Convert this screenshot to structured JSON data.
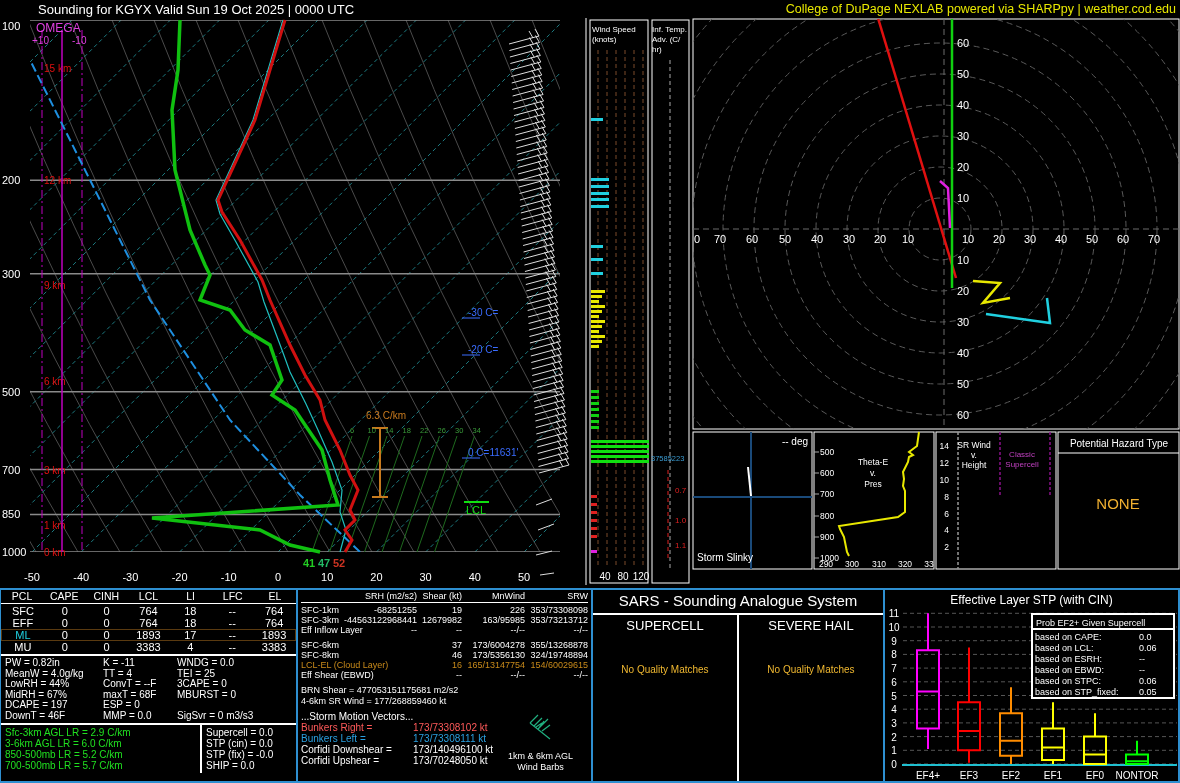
{
  "header": {
    "title": "Sounding for KGYX Valid  Sun 19 Oct 2025 | 0000 UTC",
    "credit": "College of DuPage NEXLAB powered via SHARPpy | weather.cod.edu"
  },
  "skew_t": {
    "pressure_labels": [
      "100",
      "200",
      "300",
      "500",
      "700",
      "850",
      "1000"
    ],
    "temperature_labels": [
      "-50",
      "-40",
      "-30",
      "-20",
      "-10",
      "0",
      "10",
      "20",
      "30",
      "40",
      "50"
    ],
    "height_labels": [
      "15 km",
      "12 km",
      "9 km",
      "6 km",
      "3 km",
      "1 km",
      "0 km"
    ],
    "omega": {
      "title": "OMEGA",
      "ticks": [
        "+10",
        "-10"
      ]
    },
    "lapse_rate": "6.3 C/km",
    "mixing_ratio_labels": [
      "6",
      "10",
      "14",
      "18",
      "22",
      "26",
      "30",
      "34"
    ],
    "level_labels": [
      "-30 C=",
      "-20 C=",
      "0 C=11631'"
    ],
    "lcl_label": "LCL",
    "surface_values": [
      {
        "text": "41",
        "color": "#22cc22"
      },
      {
        "text": "47",
        "color": "#22bb66"
      },
      {
        "text": "52",
        "color": "#cc3322"
      }
    ]
  },
  "wind_speed": {
    "title_lines": [
      "Wind Speed",
      "(knots)"
    ],
    "axis_labels": [
      "40",
      "80",
      "120"
    ]
  },
  "temp_advection": {
    "title_lines": [
      "Inf. Temp.",
      "Adv. (C/",
      "hr)"
    ],
    "values": [
      "0.7",
      "1.0",
      "1.1"
    ],
    "side_value": "37585223"
  },
  "hodograph": {
    "up_labels": [
      "60",
      "50",
      "40",
      "30",
      "20",
      "10"
    ],
    "down_labels": [
      "10",
      "20",
      "30",
      "40",
      "50",
      "60"
    ],
    "left_labels": [
      "0",
      "70",
      "60",
      "50",
      "40",
      "30",
      "20",
      "10"
    ],
    "right_labels": [
      "10",
      "20",
      "30",
      "40",
      "50",
      "60",
      "70"
    ]
  },
  "storm_slinky": {
    "direction": "-- deg",
    "title": "Storm Slinky"
  },
  "theta_e": {
    "title_lines": [
      "Theta-E",
      "v.",
      "Pres"
    ],
    "pressure_labels": [
      "500",
      "600",
      "700",
      "800",
      "900",
      "1000"
    ],
    "theta_labels": [
      "290",
      "300",
      "310",
      "320",
      "33"
    ]
  },
  "sr_wind": {
    "title_lines": [
      "SR Wind",
      "v.",
      "Height"
    ],
    "height_labels": [
      "14",
      "12",
      "10",
      "8",
      "6",
      "4",
      "2"
    ],
    "classic_lines": [
      "Classic",
      "Supercell"
    ]
  },
  "hazard": {
    "title": "Potential Hazard Type",
    "value": "NONE"
  },
  "thermo": {
    "columns": [
      "PCL",
      "CAPE",
      "CINH",
      "LCL",
      "LI",
      "LFC",
      "EL"
    ],
    "parcels": [
      {
        "cells": [
          "SFC",
          "0",
          "0",
          "764",
          "18",
          "--",
          "764"
        ],
        "selected": false
      },
      {
        "cells": [
          "EFF",
          "0",
          "0",
          "764",
          "18",
          "--",
          "764"
        ],
        "selected": false
      },
      {
        "cells": [
          "ML",
          "0",
          "0",
          "1893",
          "17",
          "--",
          "1893"
        ],
        "selected": true
      },
      {
        "cells": [
          "MU",
          "0",
          "0",
          "3383",
          "4",
          "--",
          "3383"
        ],
        "selected": false
      }
    ],
    "indices": [
      [
        "PW = 0.82in",
        "K = -11",
        "WNDG = 0.0"
      ],
      [
        "MeanW = 4.0g/kg",
        "TT = 4",
        "TEI = 25"
      ],
      [
        "LowRH = 44%",
        "ConvT = --F",
        "3CAPE = 0"
      ],
      [
        "MidRH = 67%",
        "maxT = 68F",
        "MBURST = 0"
      ],
      [
        "DCAPE = 197",
        "ESP = 0"
      ],
      [
        "DownT = 46F",
        "MMP = 0.0",
        "SigSvr = 0 m3/s3"
      ]
    ],
    "lapse_rates": [
      "Sfc-3km AGL LR = 2.9 C/km",
      "3-6km AGL LR = 6.0 C/km",
      "850-500mb LR = 5.2 C/km",
      "700-500mb LR = 5.7 C/km"
    ],
    "composites": [
      "Supercell = 0.0",
      "STP (cin) = 0.0",
      "STP (fix) = -0.0",
      "SHIP = 0.0"
    ]
  },
  "kinematics": {
    "columns": [
      "SRH (m2/s2)",
      "Shear (kt)",
      "MnWind",
      "SRW"
    ],
    "groups": [
      [
        {
          "label": "SFC-1km",
          "srh": "-68251255",
          "shear": "19",
          "mnwind": "226",
          "srw": "353/73308098",
          "kind": "normal"
        },
        {
          "label": "SFC-3km",
          "srh": "-44563122968441",
          "shear": "12679982",
          "mnwind": "163/95985",
          "srw": "353/73213712",
          "kind": "normal"
        },
        {
          "label": "Eff Inflow Layer",
          "srh": "--",
          "shear": "--",
          "mnwind": "--/--",
          "srw": "--/--",
          "kind": "normal"
        }
      ],
      [
        {
          "label": "SFC-6km",
          "shear": "37",
          "mnwind": "173/6004278",
          "srw": "355/13268878",
          "kind": "normal"
        },
        {
          "label": "SFC-8km",
          "shear": "46",
          "mnwind": "173/5356130",
          "srw": "324/19748894",
          "kind": "normal"
        },
        {
          "label": "LCL-EL (Cloud Layer)",
          "shear": "16",
          "mnwind": "165/13147754",
          "srw": "154/60029615",
          "kind": "cloud"
        },
        {
          "label": "Eff Shear (EBWD)",
          "shear": "--",
          "mnwind": "--/--",
          "srw": "--/--",
          "kind": "normal"
        }
      ]
    ],
    "summary": [
      "BRN Shear = 477053151175681 m2/s2",
      "4-6km SR Wind = 177/268859460 kt"
    ],
    "storm_motion_title": "...Storm Motion Vectors...",
    "storm_motions": [
      {
        "label": "Bunkers Right =",
        "value": "173/73308102 kt",
        "color": "#ff5a5a"
      },
      {
        "label": "Bunkers Left =",
        "value": "173/73308111 kt",
        "color": "#2aa0e0"
      },
      {
        "label": "Corfidi Downshear =",
        "value": "173/140496100 kt",
        "color": "#ffffff"
      },
      {
        "label": "Corfidi Upshear =",
        "value": "173/70248050 kt",
        "color": "#ffffff"
      }
    ],
    "barb_caption_lines": [
      "1km & 6km AGL",
      "Wind Barbs"
    ]
  },
  "sars": {
    "title": "SARS - Sounding Analogue System",
    "columns": [
      {
        "title": "SUPERCELL",
        "result": "No Quality Matches"
      },
      {
        "title": "SEVERE HAIL",
        "result": "No Quality Matches"
      }
    ]
  },
  "stp": {
    "title": "Effective Layer STP (with CIN)",
    "yticks": [
      "11",
      "10",
      "9",
      "8",
      "7",
      "6",
      "5",
      "4",
      "3",
      "2",
      "1",
      "0"
    ],
    "categories": [
      {
        "label": "EF4+",
        "color": "#ff00ff"
      },
      {
        "label": "EF3",
        "color": "#ff0000"
      },
      {
        "label": "EF2",
        "color": "#ff8c00"
      },
      {
        "label": "EF1",
        "color": "#ffff00"
      },
      {
        "label": "EF0",
        "color": "#ffff00"
      },
      {
        "label": "NONTOR",
        "color": "#00ff00"
      }
    ],
    "prob": {
      "title": "Prob EF2+ Given Supercell",
      "rows": [
        {
          "label": "based on CAPE:",
          "value": "0.0"
        },
        {
          "label": "based on LCL:",
          "value": "0.06"
        },
        {
          "label": "based on ESRH:",
          "value": "--"
        },
        {
          "label": "based on EBWD:",
          "value": "--"
        },
        {
          "label": "based on STPC:",
          "value": "0.06"
        },
        {
          "label": "based on STP_fixed:",
          "value": "0.05"
        }
      ]
    }
  }
}
